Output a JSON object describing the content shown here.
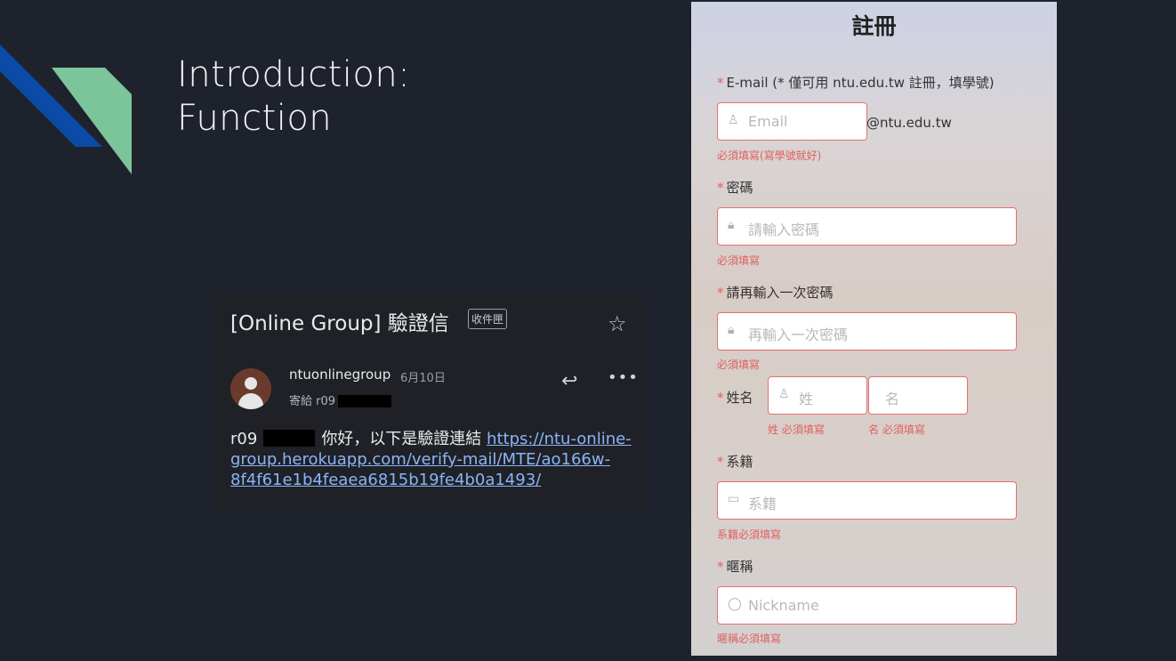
{
  "slide": {
    "title_line1": "Introduction:",
    "title_line2": "Function",
    "accent_blue": "#0b4aa6",
    "accent_green": "#7cc49a"
  },
  "email": {
    "subject": "[Online Group] 驗證信",
    "folder_badge": "收件匣",
    "sender": "ntuonlinegroup",
    "date": "6月10日",
    "recipient_prefix": "寄給 r09",
    "body_prefix": "r09",
    "body_text": "你好，以下是驗證連結 ",
    "link": "https://ntu-online-group.herokuapp.com/verify-mail/MTE/ao166w-8f4f61e1b4feaea6815b19fe4b0a1493/",
    "icons": {
      "star": "star-icon",
      "reply": "reply-icon",
      "more": "more-icon"
    }
  },
  "form": {
    "title": "註冊",
    "email_label": "E-mail (* 僅可用 ntu.edu.tw 註冊，填學號)",
    "email_placeholder": "Email",
    "email_suffix": "@ntu.edu.tw",
    "email_error": "必須填寫(寫學號就好)",
    "password_label": "密碼",
    "password_placeholder": "請輸入密碼",
    "password_error": "必須填寫",
    "confirm_label": "請再輸入一次密碼",
    "confirm_placeholder": "再輸入一次密碼",
    "confirm_error": "必須填寫",
    "name_label": "姓名",
    "lastname_placeholder": "姓",
    "firstname_placeholder": "名",
    "lastname_error": "姓 必須填寫",
    "firstname_error": "名 必須填寫",
    "dept_label": "系籍",
    "dept_placeholder": "系籍",
    "dept_error": "系籍必須填寫",
    "nick_label": "暱稱",
    "nick_placeholder": "Nickname",
    "nick_error": "暱稱必須填寫",
    "required_mark": "*"
  }
}
